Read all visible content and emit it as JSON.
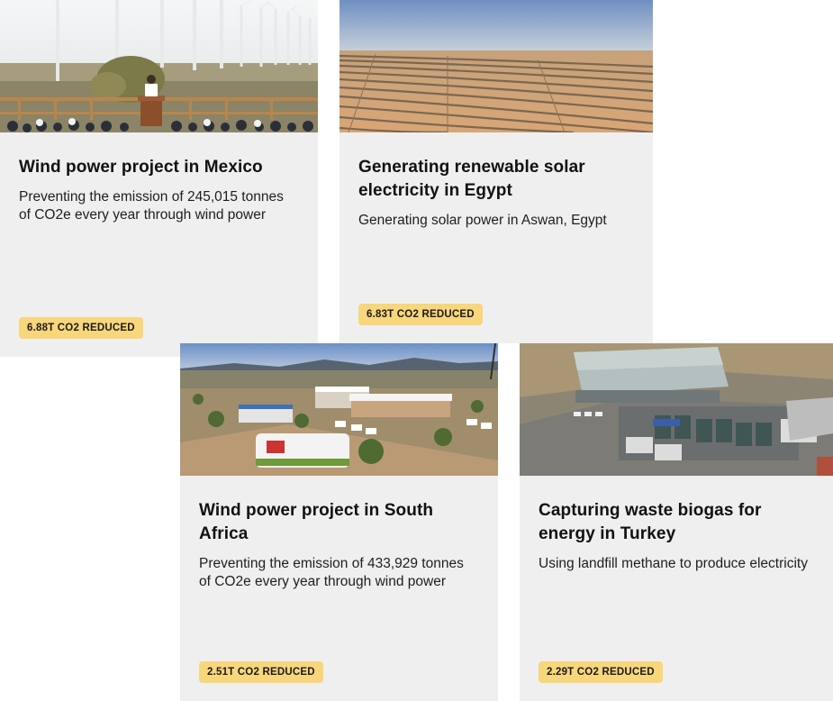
{
  "cards": [
    {
      "title": "Wind power project in Mexico",
      "description": "Preventing the emission of 245,015 tonnes of CO2e every year through wind power",
      "badge": "6.88T CO2 REDUCED"
    },
    {
      "title": "Generating renewable solar electricity in Egypt",
      "description": "Generating solar power in Aswan, Egypt",
      "badge": "6.83T CO2 REDUCED"
    },
    {
      "title": "Wind power project in South Africa",
      "description": "Preventing the emission of 433,929 tonnes of CO2e every year through wind power",
      "badge": "2.51T CO2 REDUCED"
    },
    {
      "title": "Capturing waste biogas for energy in Turkey",
      "description": "Using landfill methane to produce electricity",
      "badge": "2.29T CO2 REDUCED"
    }
  ],
  "colors": {
    "card_bg": "#efefef",
    "badge_bg": "#f8d67c",
    "title": "#111111"
  }
}
